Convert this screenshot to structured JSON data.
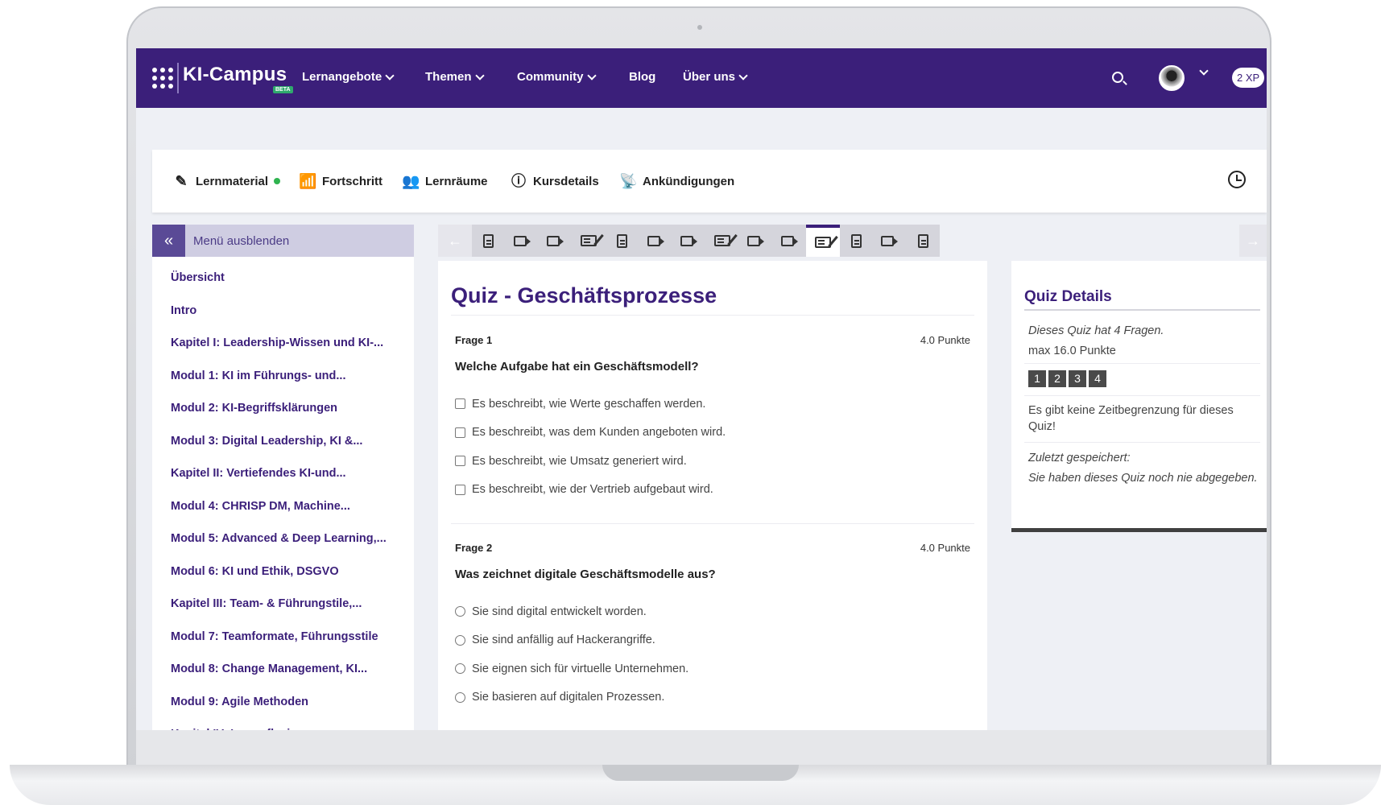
{
  "navbar": {
    "logo": "KI-Campus",
    "beta": "BETA",
    "items": [
      {
        "label": "Lernangebote",
        "dropdown": true
      },
      {
        "label": "Themen",
        "dropdown": true
      },
      {
        "label": "Community",
        "dropdown": true
      },
      {
        "label": "Blog",
        "dropdown": false
      },
      {
        "label": "Über uns",
        "dropdown": true
      }
    ],
    "xp": "2 XP",
    "accent": "#3b1f7a"
  },
  "course_tabs": [
    {
      "label": "Lernmaterial",
      "icon": "lectern-icon",
      "has_dot": true
    },
    {
      "label": "Fortschritt",
      "icon": "progress-chart-icon"
    },
    {
      "label": "Lernräume",
      "icon": "people-group-icon"
    },
    {
      "label": "Kursdetails",
      "icon": "info-icon"
    },
    {
      "label": "Ankündigungen",
      "icon": "broadcast-icon"
    }
  ],
  "menu": {
    "toggle_label": "Menü ausblenden",
    "items": [
      "Übersicht",
      "Intro",
      "Kapitel I: Leadership-Wissen und KI-...",
      "Modul 1: KI im Führungs- und...",
      "Modul 2: KI-Begriffsklärungen",
      "Modul 3: Digital Leadership, KI &...",
      "Kapitel II: Vertiefendes KI-und...",
      "Modul 4: CHRISP DM, Machine...",
      "Modul 5: Advanced & Deep Learning,...",
      "Modul 6: KI und Ethik, DSGVO",
      "Kapitel III: Team- & Führungstile,...",
      "Modul 7: Teamformate, Führungsstile",
      "Modul 8: Change Management, KI...",
      "Modul 9: Agile Methoden",
      "Kapitel IV: Lernreflexion"
    ]
  },
  "unit_nav": {
    "items": [
      "document",
      "video",
      "video",
      "quiz",
      "document",
      "video",
      "video",
      "quiz",
      "video",
      "video",
      "quiz",
      "document",
      "video",
      "document"
    ],
    "active_index": 10
  },
  "quiz": {
    "title": "Quiz - Geschäftsprozesse",
    "questions": [
      {
        "number": "Frage 1",
        "points": "4.0 Punkte",
        "text": "Welche Aufgabe hat ein Geschäftsmodell?",
        "type": "checkbox",
        "options": [
          "Es beschreibt, wie Werte geschaffen werden.",
          "Es beschreibt, was dem Kunden angeboten wird.",
          "Es beschreibt, wie Umsatz generiert wird.",
          "Es beschreibt, wie der Vertrieb aufgebaut wird."
        ]
      },
      {
        "number": "Frage 2",
        "points": "4.0 Punkte",
        "text": "Was zeichnet digitale Geschäftsmodelle aus?",
        "type": "radio",
        "options": [
          "Sie sind digital entwickelt worden.",
          "Sie sind anfällig auf Hackerangriffe.",
          "Sie eignen sich für virtuelle Unternehmen.",
          "Sie basieren auf digitalen Prozessen."
        ]
      }
    ]
  },
  "details": {
    "title": "Quiz Details",
    "question_count": "Dieses Quiz hat 4 Fragen.",
    "max_points": "max 16.0 Punkte",
    "question_badges": [
      "1",
      "2",
      "3",
      "4"
    ],
    "time_limit": "Es gibt keine Zeitbegrenzung für dieses Quiz!",
    "last_saved_label": "Zuletzt gespeichert:",
    "last_saved_text": "Sie haben dieses Quiz noch nie abgegeben."
  }
}
